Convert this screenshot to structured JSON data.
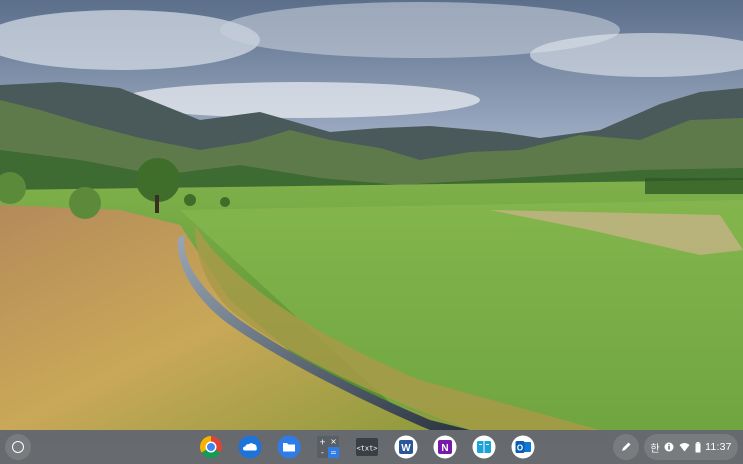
{
  "desktop": {
    "wallpaper": "mountain-valley-meadow-stream",
    "colors": {
      "sky_top": "#5a6f8c",
      "sky_low": "#cfd7e6",
      "mountain": "#3d5a3a",
      "meadow": "#5a9a3a",
      "grass": "#c9a24e"
    }
  },
  "shelf": {
    "launcher": {
      "icon": "launcher-circle-icon"
    },
    "apps": [
      {
        "name": "Chrome",
        "icon": "chrome-icon"
      },
      {
        "name": "Cloud Storage",
        "icon": "cloud-icon"
      },
      {
        "name": "Files",
        "icon": "folder-icon"
      },
      {
        "name": "Calculator",
        "icon": "calculator-icon"
      },
      {
        "name": "Text",
        "icon": "text-editor-icon",
        "label": "<txt>"
      },
      {
        "name": "Word",
        "icon": "word-icon",
        "label": "W"
      },
      {
        "name": "OneNote",
        "icon": "onenote-icon",
        "label": "N"
      },
      {
        "name": "Reader",
        "icon": "book-reader-icon"
      },
      {
        "name": "Outlook",
        "icon": "outlook-icon",
        "label": "O"
      }
    ],
    "stylus": {
      "icon": "stylus-pen-icon"
    },
    "status_tray": {
      "ime": "한",
      "icons": [
        "info-icon",
        "wifi-icon",
        "battery-icon"
      ],
      "time": "11:37"
    }
  }
}
